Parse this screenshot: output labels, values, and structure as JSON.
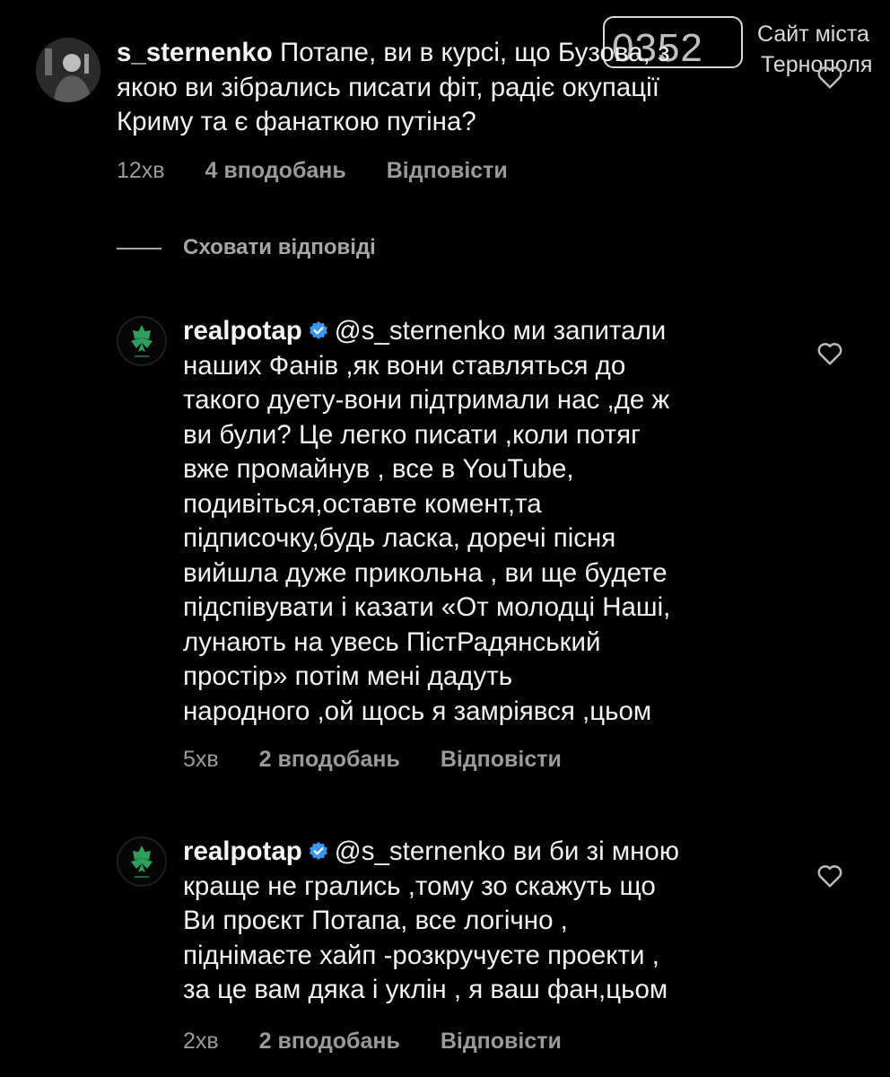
{
  "watermark": {
    "code": "0352",
    "line1": "Сайт міста",
    "line2": "Тернополя"
  },
  "comments": [
    {
      "username": "s_sternenko",
      "text_lines": [
        "Потапе, ви в курсі, що Бузова, з",
        "якою ви зібрались писати фіт, радіє окупації",
        "Криму та є фанаткою путіна?"
      ],
      "time": "12хв",
      "likes": "4 вподобань",
      "reply": "Відповісти"
    },
    {
      "username": "realpotap",
      "mention": "@s_sternenko",
      "text_lines": [
        "ми запитали",
        "наших Фанів ,як вони ставляться до",
        "такого дуету-вони підтримали нас ,де ж",
        "ви були? Це легко писати ,коли потяг",
        "вже промайнув , все в YouTube,",
        "подивіться,оставте комент,та",
        "підписочку,будь ласка, доречі пісня",
        "вийшла дуже прикольна , ви ще будете",
        "підспівувати і казати «От молодці Наші,",
        "лунають на увесь ПістРадянський",
        "простір» потім мені дадуть",
        "народного ,ой щось я замріявся ,цьом"
      ],
      "time": "5хв",
      "likes": "2 вподобань",
      "reply": "Відповісти"
    },
    {
      "username": "realpotap",
      "mention": "@s_sternenko",
      "text_lines": [
        "ви би зі мною",
        "краще не грались ,тому зо скажуть що",
        "Ви проєкт Потапа, все логічно ,",
        "піднімаєте хайп -розкручуєте проекти ,",
        "за це вам дяка і уклін , я ваш фан,цьом"
      ],
      "time": "2хв",
      "likes": "2 вподобань",
      "reply": "Відповісти"
    }
  ],
  "hide_replies": "Сховати відповіді",
  "colors": {
    "background": "#000000",
    "text": "#f2f2f2",
    "meta": "#9a9a9a",
    "verified": "#3897f0",
    "leaf": "#2e9e5b"
  }
}
